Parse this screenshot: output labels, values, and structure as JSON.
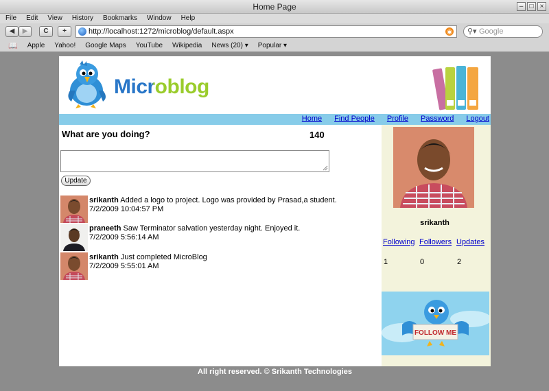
{
  "window": {
    "title": "Home Page"
  },
  "menu": [
    "File",
    "Edit",
    "View",
    "History",
    "Bookmarks",
    "Window",
    "Help"
  ],
  "toolbar": {
    "back": "◀",
    "forward": "▶",
    "reload": "C",
    "add": "+",
    "url": "http://localhost:1272/microblog/default.aspx",
    "search_placeholder": "Google"
  },
  "bookmarks": [
    "Apple",
    "Yahoo!",
    "Google Maps",
    "YouTube",
    "Wikipedia",
    "News (20) ▾",
    "Popular ▾"
  ],
  "site": {
    "logo": "Microblog",
    "nav": [
      "Home",
      "Find People",
      "Profile",
      "Password",
      "Logout"
    ],
    "prompt": "What are you doing?",
    "char_count": "140",
    "update_label": "Update",
    "posts": [
      {
        "user": "srikanth",
        "text": "Added a logo to project. Logo was provided by Prasad,a student.",
        "time": "7/2/2009 10:04:57 PM"
      },
      {
        "user": "praneeth",
        "text": "Saw Terminator salvation yesterday night. Enjoyed it.",
        "time": "7/2/2009 5:56:14 AM"
      },
      {
        "user": "srikanth",
        "text": "Just completed MicroBlog",
        "time": "7/2/2009 5:55:01 AM"
      }
    ],
    "profile": {
      "name": "srikanth",
      "following_label": "Following",
      "followers_label": "Followers",
      "updates_label": "Updates",
      "following": "1",
      "followers": "0",
      "updates": "2"
    },
    "follow_me": "FOLLOW ME",
    "footer": "All right reserved. © Srikanth Technologies"
  },
  "colors": {
    "nav_band": "#87cce9",
    "sidebar": "#f3f3dc",
    "footer": "#8c8c8c"
  }
}
